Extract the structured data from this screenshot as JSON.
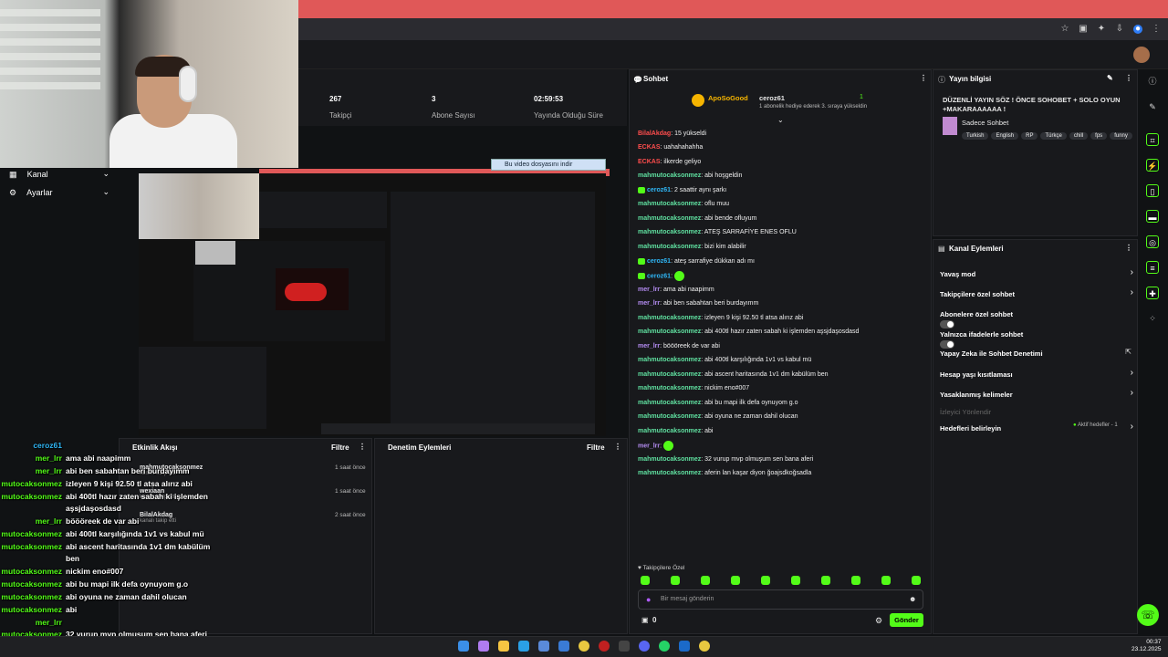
{
  "stats": [
    {
      "value": "267",
      "label": "Takipçi"
    },
    {
      "value": "3",
      "label": "Abone Sayısı"
    },
    {
      "value": "02:59:53",
      "label": "Yayında Olduğu Süre"
    }
  ],
  "nav": {
    "channel": "Kanal",
    "settings": "Ayarlar"
  },
  "video_download": "Bu video dosyasını indir",
  "activity": {
    "title": "Etkinlik Akışı",
    "filter": "Filtre",
    "events": [
      {
        "user": "mahmutocaksonmez",
        "action": "kanalı takip etti",
        "time": "1 saat önce"
      },
      {
        "user": "wexiaan",
        "action": "kanalı takip etti",
        "time": "1 saat önce"
      },
      {
        "user": "BilalAkdag",
        "action": "kanalı takip etti",
        "time": "2 saat önce"
      }
    ]
  },
  "moderation": {
    "title": "Denetim Eylemleri",
    "filter": "Filtre"
  },
  "chat": {
    "title": "Sohbet",
    "pinned": {
      "gifter": "ApoSoGood",
      "recipient": "ceroz61",
      "count": "1",
      "note": "1 abonelik hediye ederek 3. sıraya yükseldin"
    },
    "messages": [
      {
        "user": "BilalAkdag",
        "msg": "15 yükseldi",
        "color": "#ff4d4d",
        "badge": false
      },
      {
        "user": "ECKAS",
        "msg": "uahahahahha",
        "color": "#ff4d4d",
        "badge": false
      },
      {
        "user": "ECKAS",
        "msg": "ilkerde geliyo",
        "color": "#ff4d4d",
        "badge": false
      },
      {
        "user": "mahmutocaksonmez",
        "msg": "abi hoşgeldin",
        "color": "#5fe0a0",
        "badge": false
      },
      {
        "user": "ceroz61",
        "msg": "2 saattir aynı şarkı",
        "color": "#2fb6f5",
        "badge": true
      },
      {
        "user": "mahmutocaksonmez",
        "msg": "oflu muu",
        "color": "#5fe0a0",
        "badge": false
      },
      {
        "user": "mahmutocaksonmez",
        "msg": "abi bende ofluyum",
        "color": "#5fe0a0",
        "badge": false
      },
      {
        "user": "mahmutocaksonmez",
        "msg": "ATEŞ SARRAFİYE ENES OFLU",
        "color": "#5fe0a0",
        "badge": false
      },
      {
        "user": "mahmutocaksonmez",
        "msg": "bizi kim alabilir",
        "color": "#5fe0a0",
        "badge": false
      },
      {
        "user": "ceroz61",
        "msg": "ateş sarrafiye dükkan adı mı",
        "color": "#2fb6f5",
        "badge": true
      },
      {
        "user": "ceroz61",
        "msg": "",
        "color": "#2fb6f5",
        "badge": true
      },
      {
        "user": "mer_lrr",
        "msg": "ama abi naapimm",
        "color": "#b48cf2",
        "badge": false
      },
      {
        "user": "mer_lrr",
        "msg": "abi ben sabahtan beri burdayımm",
        "color": "#b48cf2",
        "badge": false
      },
      {
        "user": "mahmutocaksonmez",
        "msg": "izleyen 9 kişi 92.50 tl atsa alırız abi",
        "color": "#5fe0a0",
        "badge": false
      },
      {
        "user": "mahmutocaksonmez",
        "msg": "abi 400tl hazır zaten sabah ki işlemden aşsjdaşosdasd",
        "color": "#5fe0a0",
        "badge": false
      },
      {
        "user": "mer_lrr",
        "msg": "böööreek de var abi",
        "color": "#b48cf2",
        "badge": false
      },
      {
        "user": "mahmutocaksonmez",
        "msg": "abi 400tl karşılığında 1v1 vs kabul mü",
        "color": "#5fe0a0",
        "badge": false
      },
      {
        "user": "mahmutocaksonmez",
        "msg": "abi ascent haritasında 1v1 dm kabülüm ben",
        "color": "#5fe0a0",
        "badge": false
      },
      {
        "user": "mahmutocaksonmez",
        "msg": "nickim eno#007",
        "color": "#5fe0a0",
        "badge": false
      },
      {
        "user": "mahmutocaksonmez",
        "msg": "abi bu mapi ilk defa oynuyom g.o",
        "color": "#5fe0a0",
        "badge": false
      },
      {
        "user": "mahmutocaksonmez",
        "msg": "abi oyuna ne zaman dahil olucan",
        "color": "#5fe0a0",
        "badge": false
      },
      {
        "user": "mahmutocaksonmez",
        "msg": "abi",
        "color": "#5fe0a0",
        "badge": false
      },
      {
        "user": "mer_lrr",
        "msg": "",
        "color": "#b48cf2",
        "badge": false
      },
      {
        "user": "mahmutocaksonmez",
        "msg": "32 vurup mvp olmuşum sen bana aferi",
        "color": "#5fe0a0",
        "badge": false
      },
      {
        "user": "mahmutocaksonmez",
        "msg": "aferin lan kaşar diyon ğoajsdkoğsadla",
        "color": "#5fe0a0",
        "badge": false
      }
    ],
    "followers_only": "Takipçilere Özel",
    "input_placeholder": "Bir mesaj gönderin",
    "points": "0",
    "send": "Gönder"
  },
  "stream_info": {
    "title": "Yayın bilgisi",
    "stream_title": "DÜZENLİ YAYIN SÖZ ! ÖNCE SOHOBET + SOLO OYUN +MAKARAAAAAA !",
    "category": "Sadece Sohbet",
    "tags": [
      "Turkish",
      "English",
      "RP",
      "Türkçe",
      "chill",
      "fps",
      "funny"
    ]
  },
  "channel_actions": {
    "title": "Kanal Eylemleri",
    "items": [
      {
        "label": "Yavaş mod",
        "control": "chevron"
      },
      {
        "label": "Takipçilere özel sohbet",
        "control": "chevron"
      },
      {
        "label": "Abonelere özel sohbet",
        "control": "toggle"
      },
      {
        "label": "Yalnızca ifadelerle sohbet",
        "control": "toggle"
      },
      {
        "label": "Yapay Zeka ile Sohbet Denetimi",
        "control": "external"
      },
      {
        "label": "Hesap yaşı kısıtlaması",
        "control": "chevron"
      },
      {
        "label": "Yasaklanmış kelimeler",
        "control": "chevron"
      },
      {
        "label": "İzleyici Yönlendir",
        "control": "none"
      },
      {
        "label": "Hedefleri belirleyin",
        "control": "chevron"
      }
    ],
    "active_goals": "Aktif hedefler - 1"
  },
  "overlay_chat": [
    {
      "user": "ceroz61",
      "msg": "",
      "cls": "oname2"
    },
    {
      "user": "mer_lrr",
      "msg": "ama abi naapimm",
      "cls": "oname"
    },
    {
      "user": "mer_lrr",
      "msg": "abi ben sabahtan beri burdayımm",
      "cls": "oname"
    },
    {
      "user": "mutocaksonmez",
      "msg": "izleyen 9 kişi 92.50 tl atsa alırız abi",
      "cls": "oname"
    },
    {
      "user": "mutocaksonmez",
      "msg": "abi 400tl hazır zaten sabah ki işlemden",
      "cls": "oname"
    },
    {
      "user": "",
      "msg": "aşsjdaşosdasd",
      "cls": "oname"
    },
    {
      "user": "mer_lrr",
      "msg": "böööreek de var abi",
      "cls": "oname"
    },
    {
      "user": "mutocaksonmez",
      "msg": "abi 400tl karşılığında 1v1 vs kabul mü",
      "cls": "oname"
    },
    {
      "user": "mutocaksonmez",
      "msg": "abi ascent haritasında 1v1 dm kabülüm",
      "cls": "oname"
    },
    {
      "user": "",
      "msg": "ben",
      "cls": "oname"
    },
    {
      "user": "mutocaksonmez",
      "msg": "nickim eno#007",
      "cls": "oname"
    },
    {
      "user": "mutocaksonmez",
      "msg": "abi bu mapi ilk defa oynuyom g.o",
      "cls": "oname"
    },
    {
      "user": "mutocaksonmez",
      "msg": "abi oyuna ne zaman dahil olucan",
      "cls": "oname"
    },
    {
      "user": "mutocaksonmez",
      "msg": "abi",
      "cls": "oname"
    },
    {
      "user": "mer_lrr",
      "msg": "",
      "cls": "oname"
    },
    {
      "user": "mutocaksonmez",
      "msg": "32 vurup mvp olmuşum sen bana aferi",
      "cls": "oname"
    },
    {
      "user": "mutocaksonmez",
      "msg": "aferin lan kaşar diyon ğoajsdkoğsadla",
      "cls": "oname"
    }
  ],
  "taskbar": {
    "time": "00:37",
    "date": "23.12.2025"
  },
  "colors": {
    "accent": "#53fc18",
    "tab_red": "#e05858",
    "bg": "#101214",
    "panel": "#18191c"
  }
}
